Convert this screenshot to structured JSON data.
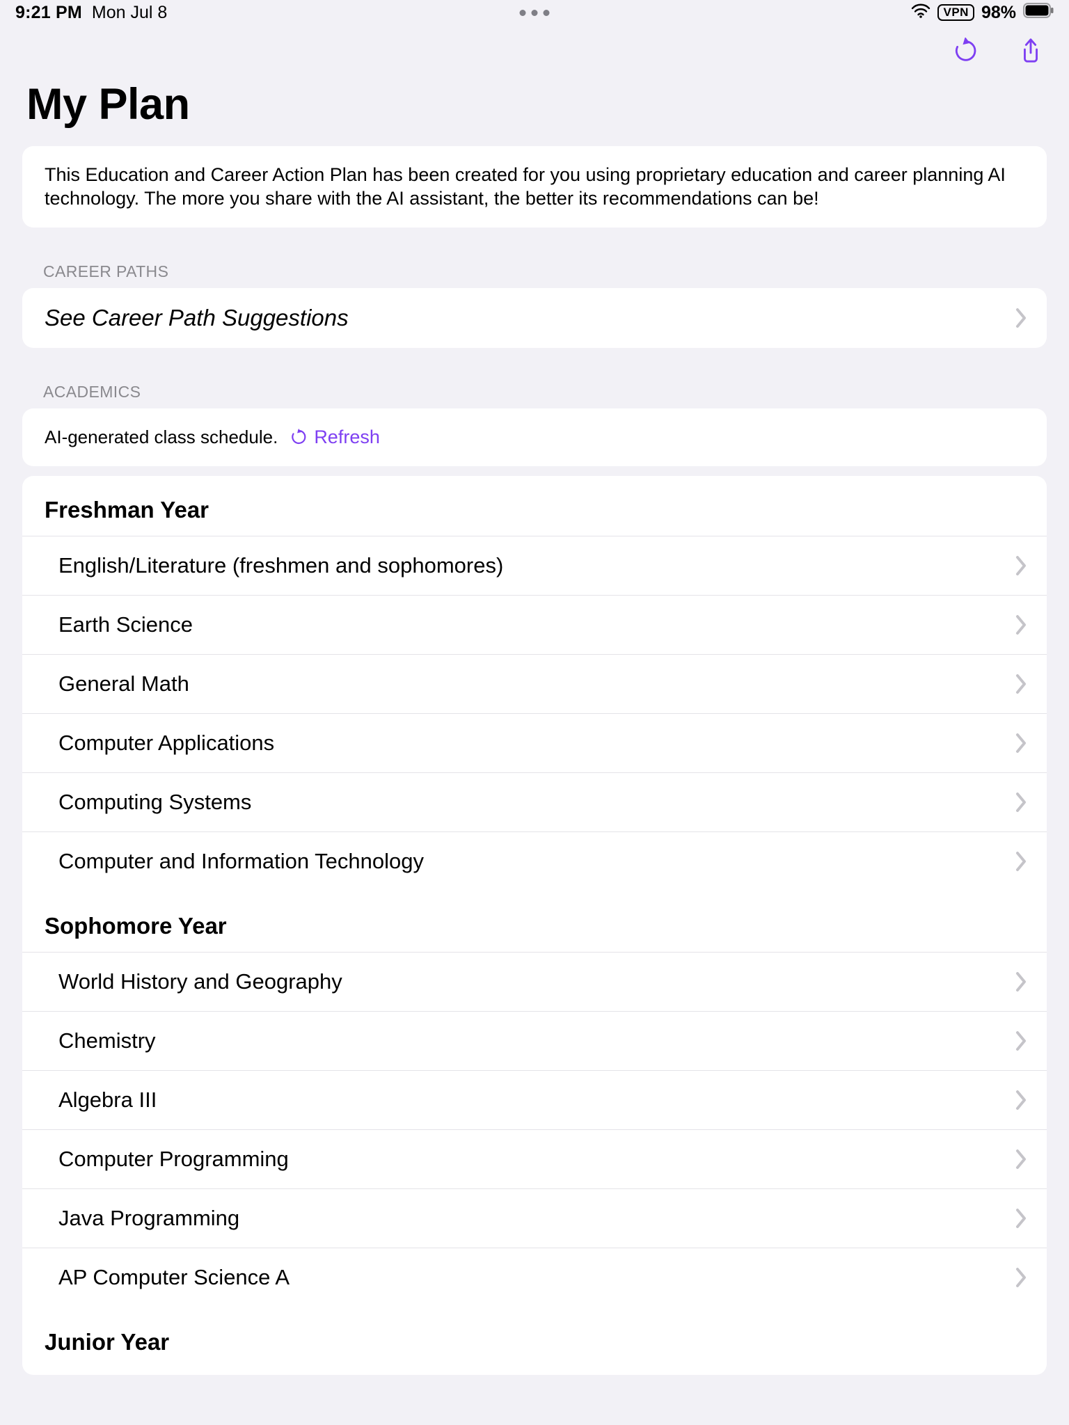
{
  "status": {
    "time": "9:21 PM",
    "date": "Mon Jul 8",
    "battery_pct": "98%",
    "vpn_label": "VPN"
  },
  "page": {
    "title": "My Plan",
    "intro": "This Education and Career Action Plan has been created for you using proprietary education and career planning AI technology. The more you share with the AI assistant, the better its recommendations can be!"
  },
  "sections": {
    "career_paths_header": "CAREER PATHS",
    "career_paths_row": "See Career Path Suggestions",
    "academics_header": "ACADEMICS",
    "schedule_caption": "AI-generated class schedule.",
    "refresh_label": "Refresh"
  },
  "schedule": [
    {
      "year": "Freshman Year",
      "courses": [
        "English/Literature (freshmen and sophomores)",
        "Earth Science",
        "General Math",
        "Computer Applications",
        "Computing Systems",
        "Computer and Information Technology"
      ]
    },
    {
      "year": "Sophomore Year",
      "courses": [
        "World History and Geography",
        "Chemistry",
        "Algebra III",
        "Computer Programming",
        "Java Programming",
        "AP Computer Science A"
      ]
    },
    {
      "year": "Junior Year",
      "courses": []
    }
  ],
  "colors": {
    "accent": "#7e3ff2"
  }
}
